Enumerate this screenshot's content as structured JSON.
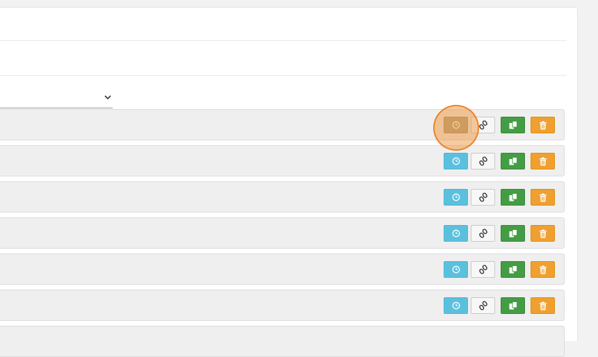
{
  "filter": {
    "selected": ""
  },
  "rows": [
    {
      "label": "",
      "active": true
    },
    {
      "label": "",
      "active": false
    },
    {
      "label": "",
      "active": false
    },
    {
      "label": "",
      "active": false
    },
    {
      "label": "",
      "active": false
    },
    {
      "label": "",
      "active": false
    }
  ],
  "actions": {
    "history_icon": "clock-icon",
    "link_icon": "link-icon",
    "copy_icon": "copy-icon",
    "delete_icon": "trash-icon"
  },
  "colors": {
    "history": "#5bc0de",
    "history_pressed": "#b2a98a",
    "link": "#f7f7f7",
    "copy": "#449d44",
    "delete": "#f0a030",
    "click_indicator": "#f08c28"
  }
}
